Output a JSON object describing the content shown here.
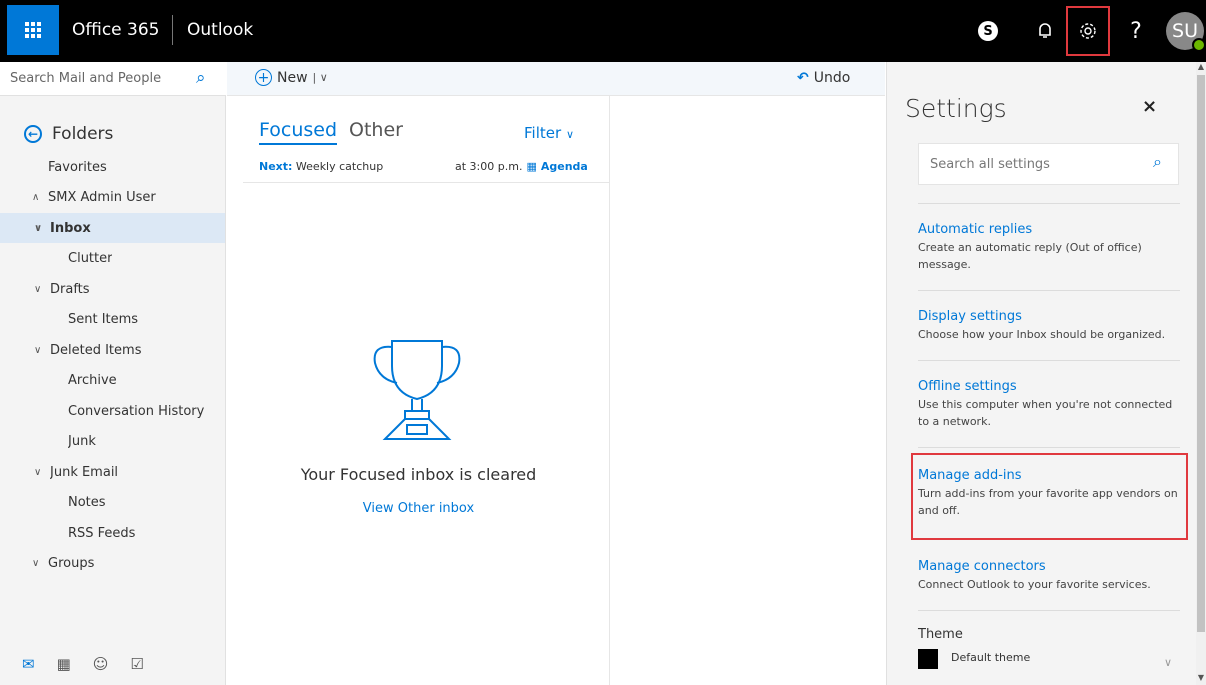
{
  "topbar": {
    "brand": "Office 365",
    "app": "Outlook",
    "skype_icon": "S",
    "help_label": "?",
    "avatar_initials": "SU"
  },
  "leftnav": {
    "search_placeholder": "Search Mail and People",
    "folders_heading": "Folders",
    "items": [
      {
        "label": "Favorites",
        "indent": 0,
        "chevron": ""
      },
      {
        "label": "SMX Admin User",
        "indent": 0,
        "chevron": "^"
      },
      {
        "label": "Inbox",
        "indent": 1,
        "chevron": "v",
        "selected": true
      },
      {
        "label": "Clutter",
        "indent": 2,
        "chevron": ""
      },
      {
        "label": "Drafts",
        "indent": 1,
        "chevron": "v"
      },
      {
        "label": "Sent Items",
        "indent": 2,
        "chevron": ""
      },
      {
        "label": "Deleted Items",
        "indent": 1,
        "chevron": "v"
      },
      {
        "label": "Archive",
        "indent": 2,
        "chevron": ""
      },
      {
        "label": "Conversation History",
        "indent": 2,
        "chevron": ""
      },
      {
        "label": "Junk",
        "indent": 2,
        "chevron": ""
      },
      {
        "label": "Junk Email",
        "indent": 1,
        "chevron": "v"
      },
      {
        "label": "Notes",
        "indent": 2,
        "chevron": ""
      },
      {
        "label": "RSS Feeds",
        "indent": 2,
        "chevron": ""
      },
      {
        "label": "Groups",
        "indent": 0,
        "chevron": "v"
      }
    ]
  },
  "toolbar": {
    "new_label": "New",
    "undo_label": "Undo"
  },
  "msglist": {
    "tab_focused": "Focused",
    "tab_other": "Other",
    "filter_label": "Filter",
    "next_label": "Next:",
    "next_event": "Weekly catchup",
    "next_time": "at 3:00 p.m.",
    "agenda_label": "Agenda",
    "empty_message": "Your Focused inbox is cleared",
    "view_other": "View Other inbox"
  },
  "settings": {
    "title": "Settings",
    "close_label": "×",
    "search_placeholder": "Search all settings",
    "options": [
      {
        "title": "Automatic replies",
        "desc": "Create an automatic reply (Out of office) message."
      },
      {
        "title": "Display settings",
        "desc": "Choose how your Inbox should be organized."
      },
      {
        "title": "Offline settings",
        "desc": "Use this computer when you're not connected to a network."
      },
      {
        "title": "Manage add-ins",
        "desc": "Turn add-ins from your favorite app vendors on and off."
      },
      {
        "title": "Manage connectors",
        "desc": "Connect Outlook to your favorite services."
      }
    ],
    "theme_label": "Theme",
    "theme_value": "Default theme"
  },
  "colors": {
    "accent": "#0078d7",
    "highlight_box": "#e0393e",
    "topbar": "#000000",
    "selected_row": "#dce8f5"
  }
}
